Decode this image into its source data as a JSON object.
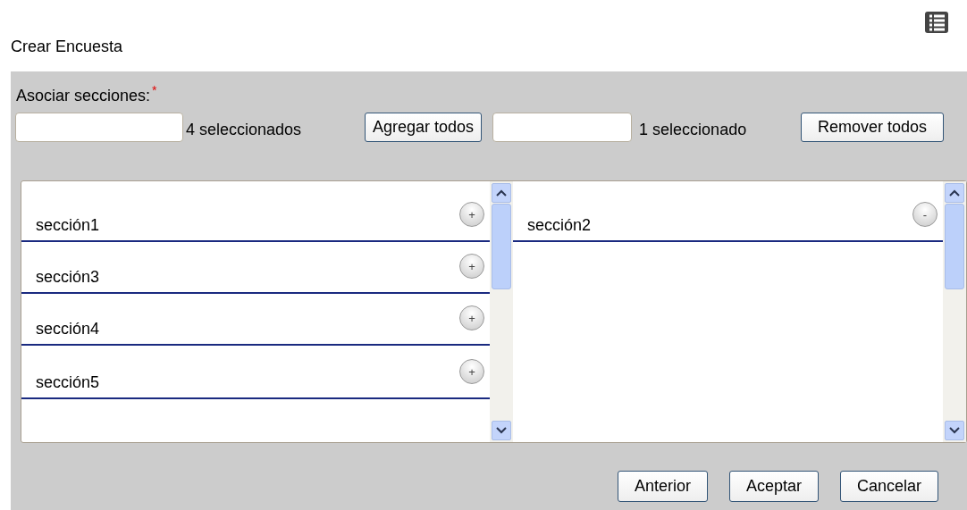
{
  "title": "Crear Encuesta",
  "field_label": "Asociar secciones:",
  "required_mark": "*",
  "available": {
    "count": "4 seleccionados",
    "button": "Agregar todos",
    "items": [
      {
        "label": "sección1",
        "action": "+"
      },
      {
        "label": "sección3",
        "action": "+"
      },
      {
        "label": "sección4",
        "action": "+"
      },
      {
        "label": "sección5",
        "action": "+"
      }
    ]
  },
  "selected": {
    "count": "1 seleccionado",
    "button": "Remover todos",
    "items": [
      {
        "label": "sección2",
        "action": "-"
      }
    ]
  },
  "buttons": [
    "Anterior",
    "Aceptar",
    "Cancelar"
  ]
}
